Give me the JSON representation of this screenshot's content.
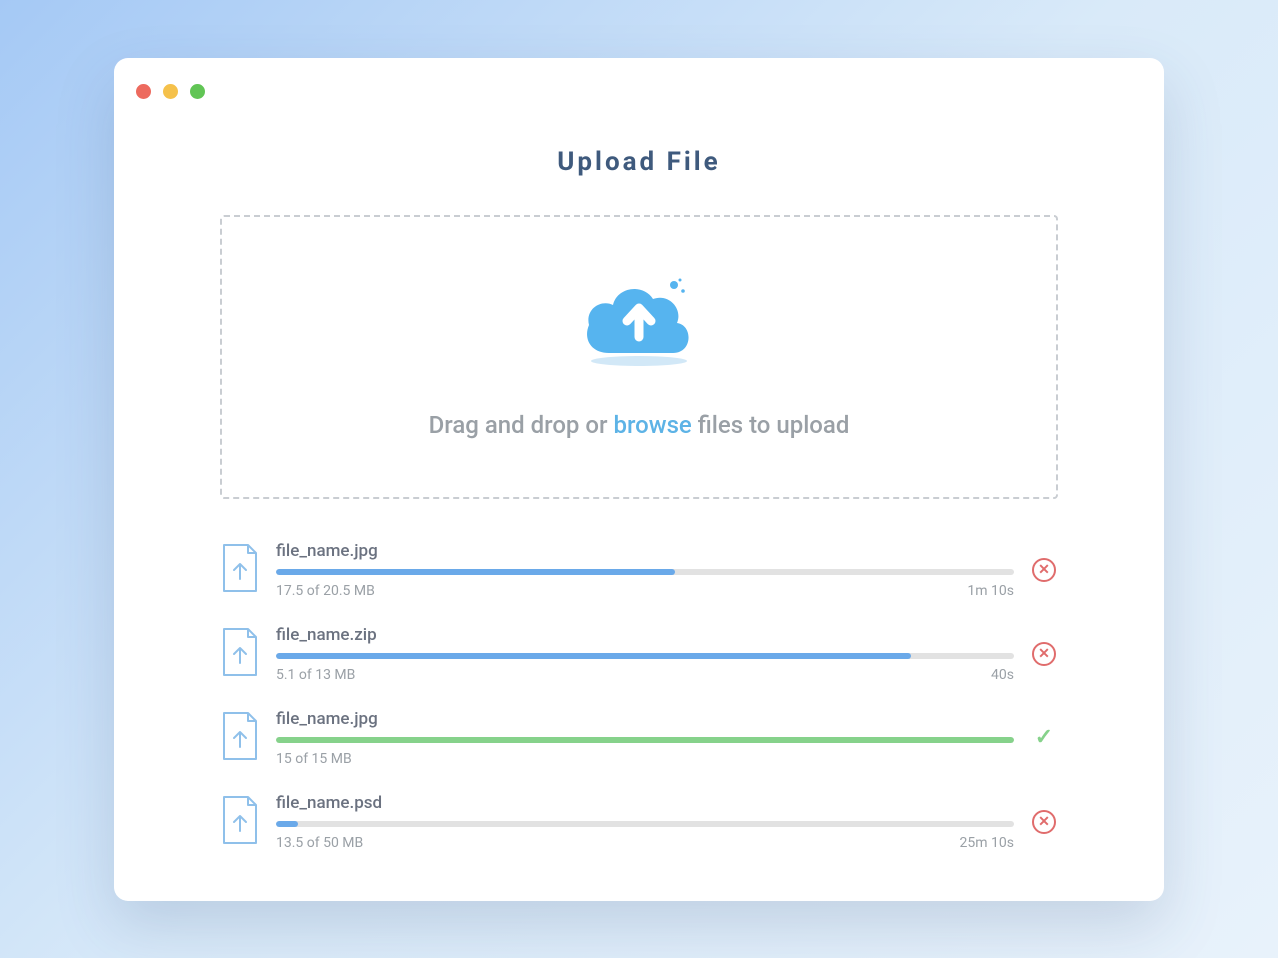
{
  "title": "Upload File",
  "dropzone": {
    "prefix": "Drag and drop or ",
    "link": "browse",
    "suffix": " files to upload"
  },
  "files": [
    {
      "name": "file_name.jpg",
      "size_text": "17.5 of 20.5 MB",
      "time_text": "1m 10s",
      "progress": 54,
      "status": "uploading",
      "color": "blue"
    },
    {
      "name": "file_name.zip",
      "size_text": "5.1 of 13 MB",
      "time_text": "40s",
      "progress": 86,
      "status": "uploading",
      "color": "blue"
    },
    {
      "name": "file_name.jpg",
      "size_text": "15 of 15 MB",
      "time_text": "",
      "progress": 100,
      "status": "complete",
      "color": "green"
    },
    {
      "name": "file_name.psd",
      "size_text": "13.5 of 50 MB",
      "time_text": "25m 10s",
      "progress": 3,
      "status": "uploading",
      "color": "blue"
    }
  ]
}
